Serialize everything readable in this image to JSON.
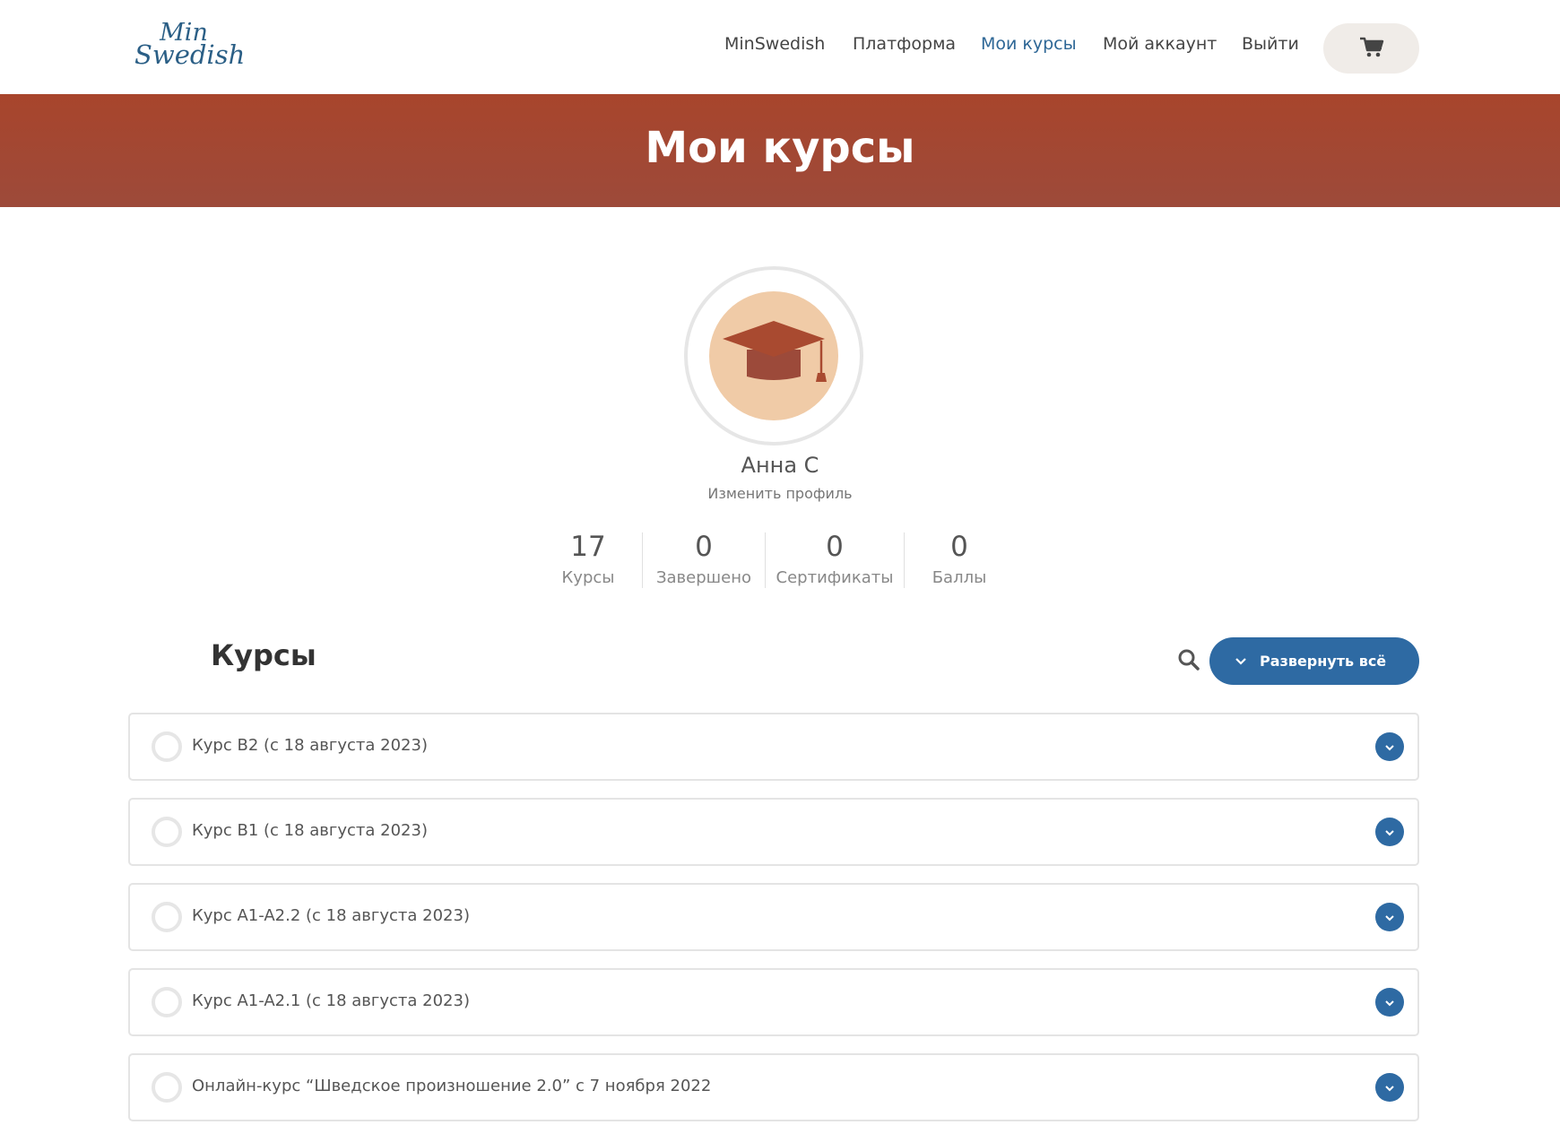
{
  "header": {
    "logo": {
      "line1": "Min",
      "line2": "Swedish"
    },
    "nav": [
      {
        "label": "MinSwedish"
      },
      {
        "label": "Платформа"
      },
      {
        "label": "Мои курсы",
        "active": true
      },
      {
        "label": "Мой аккаунт"
      },
      {
        "label": "Выйти"
      }
    ],
    "cart_icon": "shopping-cart-icon"
  },
  "banner": {
    "title": "Мои курсы"
  },
  "profile": {
    "avatar_icon": "graduation-cap-icon",
    "name": "Анна С",
    "edit_link": "Изменить профиль"
  },
  "stats": [
    {
      "value": "17",
      "label": "Курсы"
    },
    {
      "value": "0",
      "label": "Завершено"
    },
    {
      "value": "0",
      "label": "Сертификаты"
    },
    {
      "value": "0",
      "label": "Баллы"
    }
  ],
  "courses": {
    "title": "Курсы",
    "expand_label": "Развернуть всё",
    "items": [
      {
        "title": "Курс B2 (с 18 августа 2023)"
      },
      {
        "title": "Курс B1 (с 18 августа 2023)"
      },
      {
        "title": "Курс A1-A2.2 (с 18 августа 2023)"
      },
      {
        "title": "Курс A1-A2.1 (с 18 августа 2023)"
      },
      {
        "title": "Онлайн-курс “Шведское произношение 2.0” с 7 ноября 2022"
      }
    ]
  },
  "colors": {
    "accent": "#2e6aa3",
    "banner": "#a8452c",
    "avatar_bg": "#f0cba7",
    "cap": "#a94a30"
  }
}
